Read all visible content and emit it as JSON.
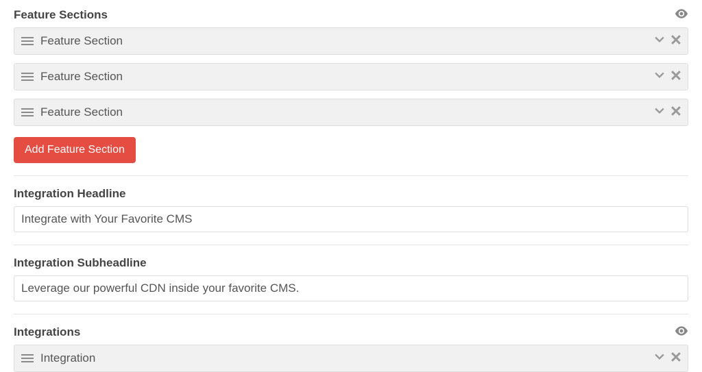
{
  "feature_sections": {
    "label": "Feature Sections",
    "items": [
      {
        "label": "Feature Section"
      },
      {
        "label": "Feature Section"
      },
      {
        "label": "Feature Section"
      }
    ],
    "add_button_label": "Add Feature Section"
  },
  "integration_headline": {
    "label": "Integration Headline",
    "value": "Integrate with Your Favorite CMS"
  },
  "integration_subheadline": {
    "label": "Integration Subheadline",
    "value": "Leverage our powerful CDN inside your favorite CMS."
  },
  "integrations": {
    "label": "Integrations",
    "items": [
      {
        "label": "Integration"
      }
    ]
  },
  "colors": {
    "button_bg": "#e54d42"
  }
}
